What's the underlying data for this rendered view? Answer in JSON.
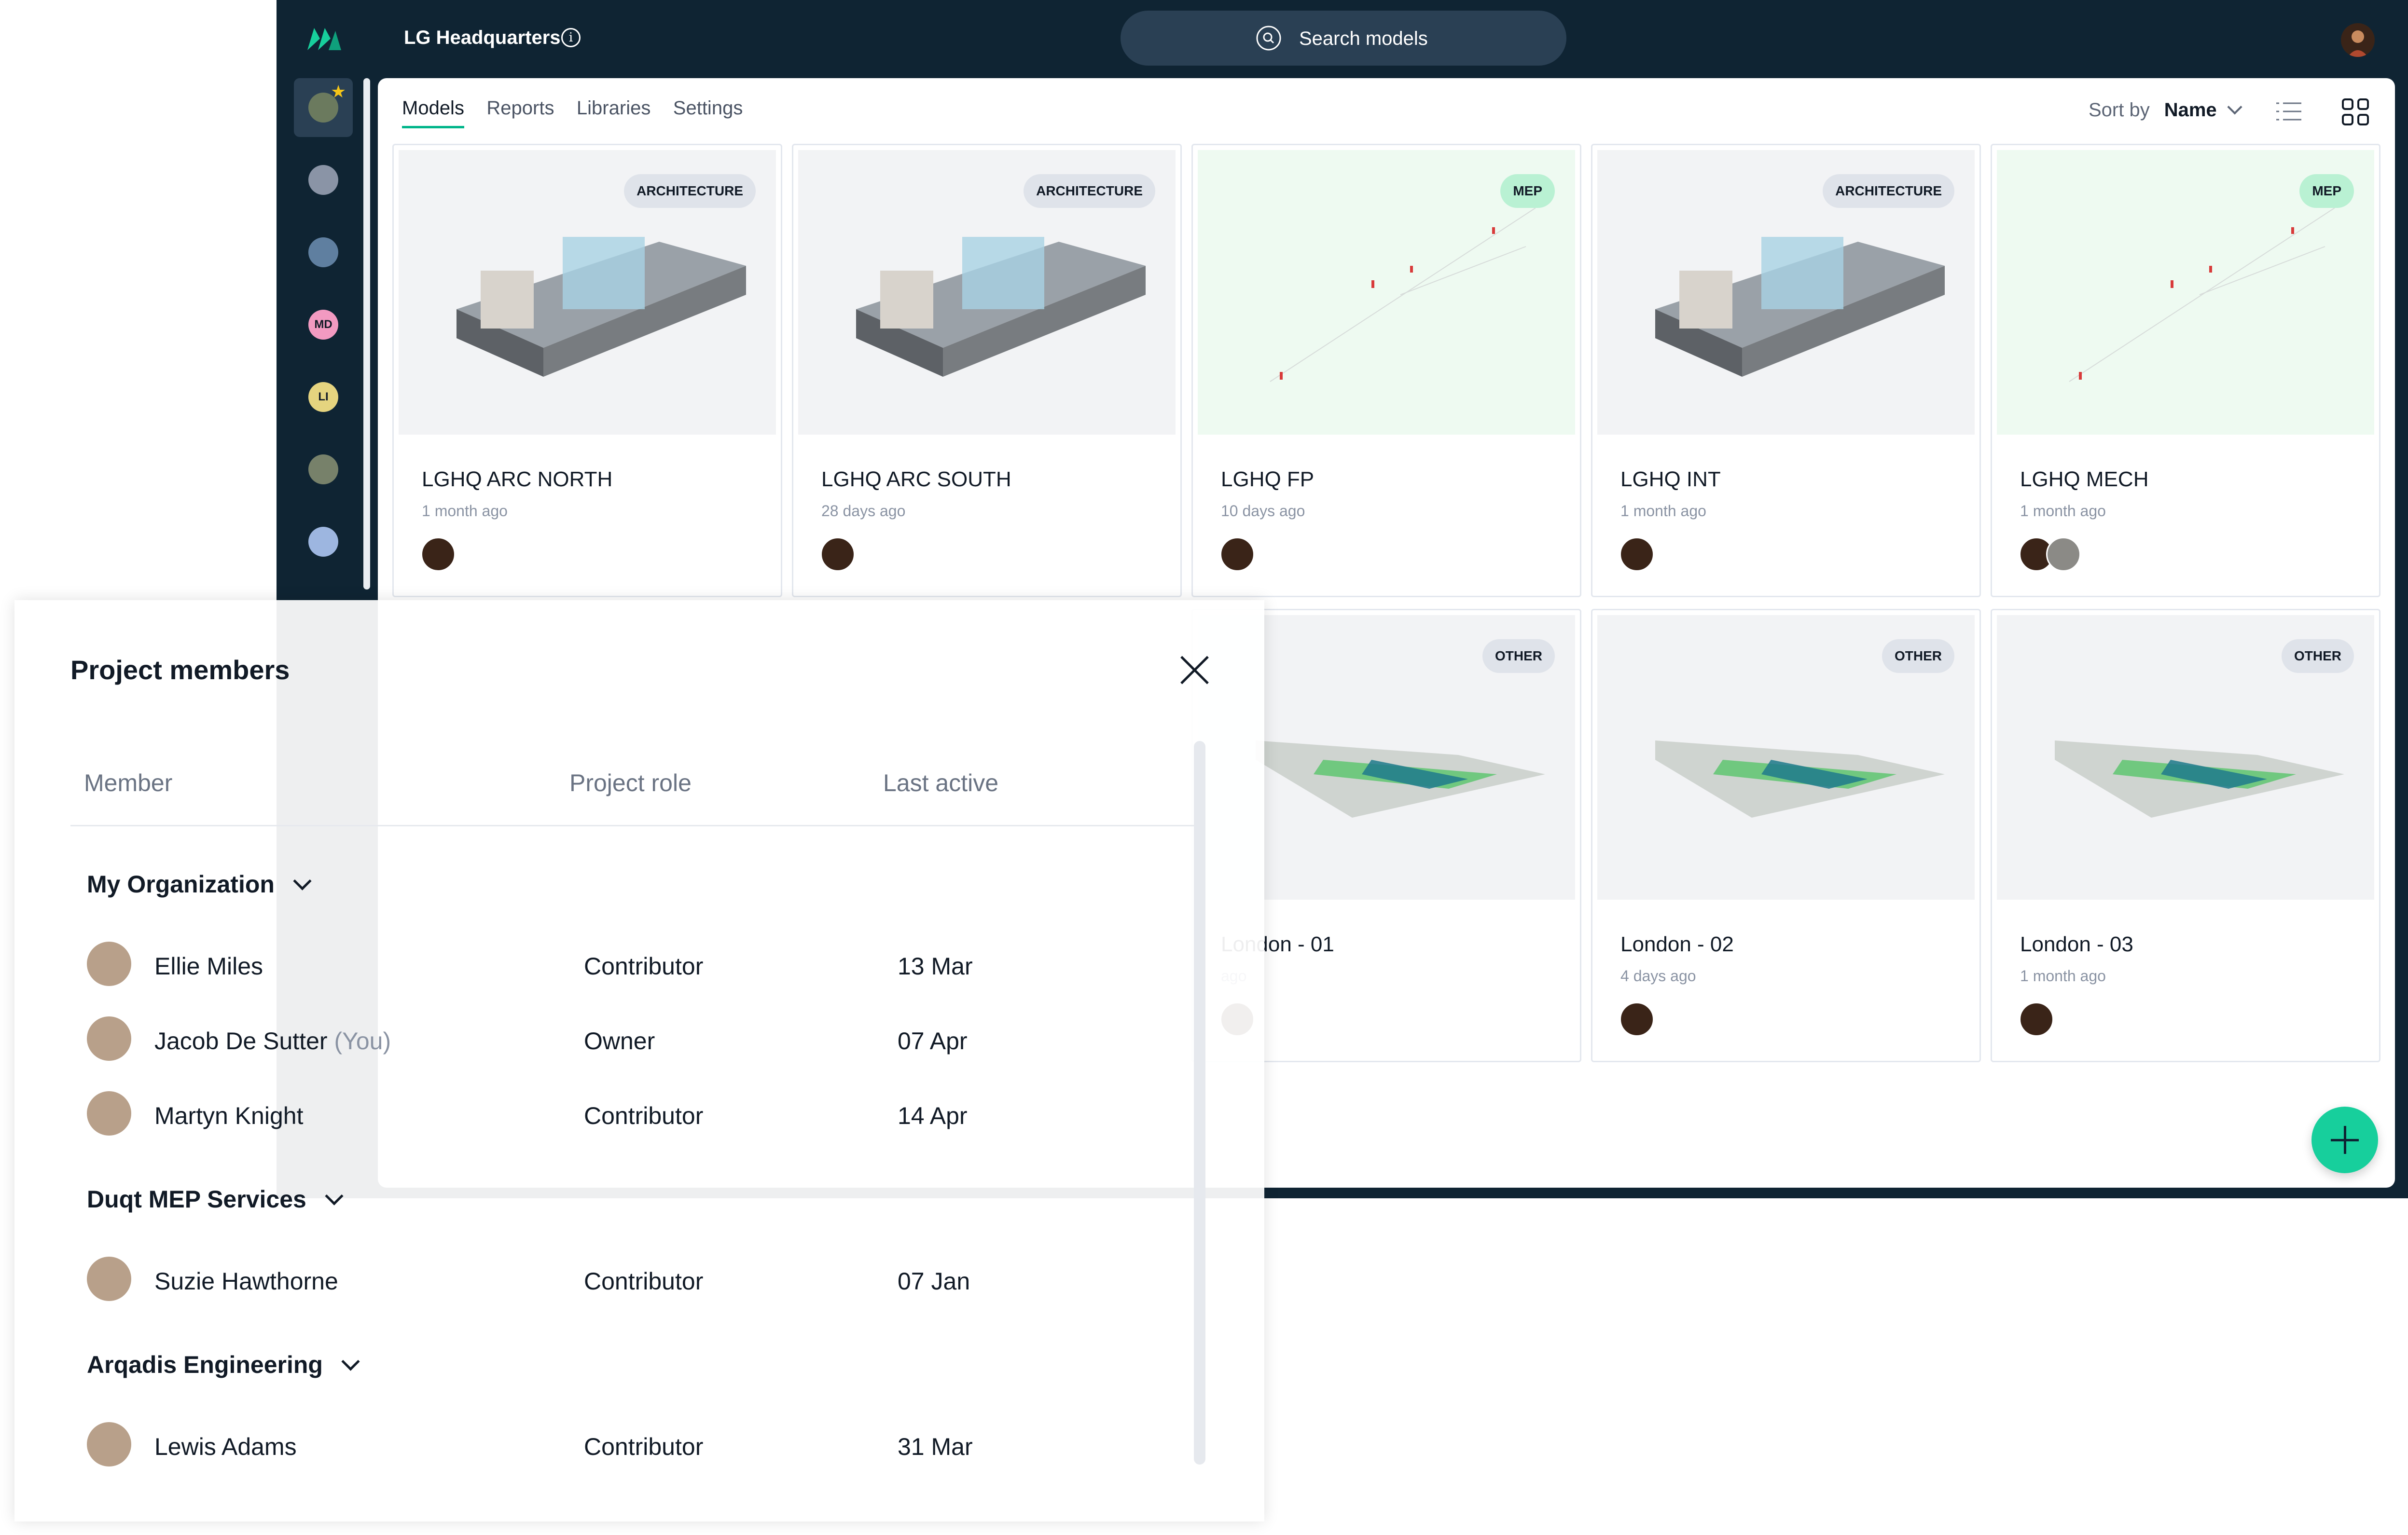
{
  "app": {
    "project_title": "LG Headquarters",
    "search_label": "Search models"
  },
  "rail": {
    "items": [
      {
        "kind": "image",
        "color": "#6b7a5e",
        "active": true
      },
      {
        "kind": "image",
        "color": "#8a94a6"
      },
      {
        "kind": "image",
        "color": "#5f7fa0"
      },
      {
        "kind": "initials",
        "text": "MD",
        "color": "#f29ac1"
      },
      {
        "kind": "initials",
        "text": "LI",
        "color": "#e5d47f"
      },
      {
        "kind": "image",
        "color": "#77816a"
      },
      {
        "kind": "image",
        "color": "#9db6e0"
      }
    ]
  },
  "tabs": [
    "Models",
    "Reports",
    "Libraries",
    "Settings"
  ],
  "sort": {
    "label": "Sort by",
    "value": "Name"
  },
  "models": [
    {
      "title": "LGHQ ARC NORTH",
      "updated": "1 month ago",
      "tag": "ARCHITECTURE",
      "avatars": 1
    },
    {
      "title": "LGHQ ARC SOUTH",
      "updated": "28 days ago",
      "tag": "ARCHITECTURE",
      "avatars": 1
    },
    {
      "title": "LGHQ FP",
      "updated": "10 days ago",
      "tag": "MEP",
      "avatars": 1
    },
    {
      "title": "LGHQ INT",
      "updated": "1 month ago",
      "tag": "ARCHITECTURE",
      "avatars": 1
    },
    {
      "title": "LGHQ MECH",
      "updated": "1 month ago",
      "tag": "MEP",
      "avatars": 2
    },
    {
      "title": "London - 01",
      "updated": "ago",
      "tag": "OTHER",
      "avatars": 1
    },
    {
      "title": "London - 02",
      "updated": "4 days ago",
      "tag": "OTHER",
      "avatars": 1
    },
    {
      "title": "London - 03",
      "updated": "1 month ago",
      "tag": "OTHER",
      "avatars": 1
    }
  ],
  "members_panel": {
    "title": "Project members",
    "columns": [
      "Member",
      "Project role",
      "Last active"
    ],
    "groups": [
      {
        "name": "My Organization",
        "members": [
          {
            "name": "Ellie Miles",
            "you": "",
            "role": "Contributor",
            "last": "13 Mar"
          },
          {
            "name": "Jacob De Sutter",
            "you": "(You)",
            "role": "Owner",
            "last": "07 Apr"
          },
          {
            "name": "Martyn Knight",
            "you": "",
            "role": "Contributor",
            "last": "14 Apr"
          }
        ]
      },
      {
        "name": "Duqt MEP Services",
        "members": [
          {
            "name": "Suzie Hawthorne",
            "you": "",
            "role": "Contributor",
            "last": "07 Jan"
          }
        ]
      },
      {
        "name": "Arqadis Engineering",
        "members": [
          {
            "name": "Lewis Adams",
            "you": "",
            "role": "Contributor",
            "last": "31 Mar"
          }
        ]
      }
    ]
  },
  "colors": {
    "brand_dark": "#0f2433",
    "accent": "#17cf9c",
    "tab_underline": "#00b58a"
  }
}
